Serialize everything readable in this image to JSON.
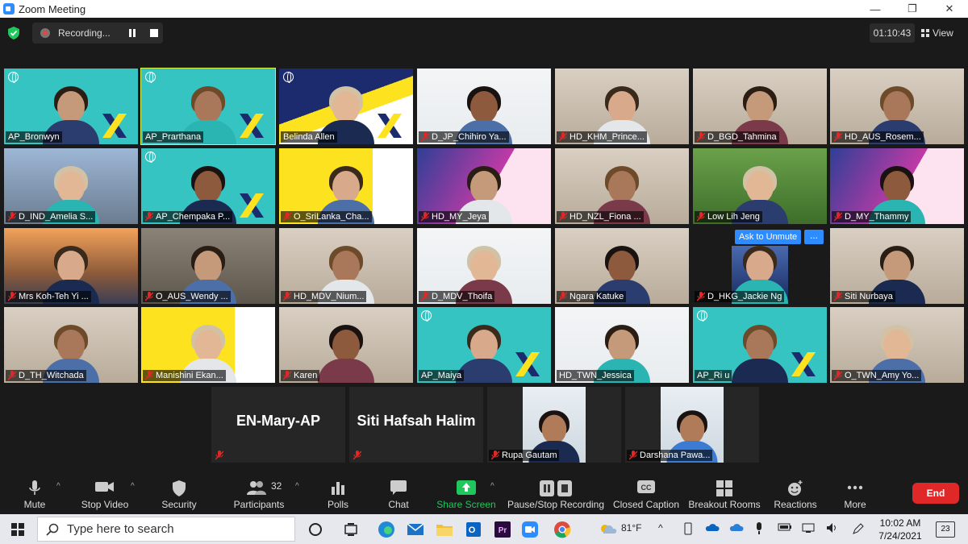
{
  "window": {
    "title": "Zoom Meeting"
  },
  "meeting": {
    "recording_label": "Recording...",
    "timer": "01:10:43",
    "view_label": "View"
  },
  "colors": {
    "teal": "#35c4c1",
    "yellow": "#fde21f",
    "navy": "#1c2b6e",
    "accent_blue": "#2d8cff",
    "end_red": "#e02828",
    "share_green": "#1fc75c"
  },
  "participants": [
    {
      "name": "AP_Bronwyn",
      "muted": false,
      "bg": "teal"
    },
    {
      "name": "AP_Prarthana",
      "muted": false,
      "bg": "teal",
      "active": true
    },
    {
      "name": "Belinda Allen",
      "muted": false,
      "bg": "navyyellow"
    },
    {
      "name": "D_JP_Chihiro Ya...",
      "muted": true,
      "bg": "white"
    },
    {
      "name": "HD_KHM_Prince...",
      "muted": true,
      "bg": "room"
    },
    {
      "name": "D_BGD_Tahmina",
      "muted": true,
      "bg": "room"
    },
    {
      "name": "HD_AUS_Rosem...",
      "muted": true,
      "bg": "room"
    },
    {
      "name": "D_IND_Amelia S...",
      "muted": true,
      "bg": "city"
    },
    {
      "name": "AP_Chempaka P...",
      "muted": true,
      "bg": "teal"
    },
    {
      "name": "O_SriLanka_Cha...",
      "muted": true,
      "bg": "yellow"
    },
    {
      "name": "HD_MY_Jeya",
      "muted": true,
      "bg": "wagggs"
    },
    {
      "name": "HD_NZL_Fiona ...",
      "muted": true,
      "bg": "room"
    },
    {
      "name": "Low Lih Jeng",
      "muted": true,
      "bg": "garden"
    },
    {
      "name": "D_MY_Thammy",
      "muted": true,
      "bg": "wagggs"
    },
    {
      "name": "Mrs Koh-Teh Yi ...",
      "muted": true,
      "bg": "sunset"
    },
    {
      "name": "O_AUS_Wendy ...",
      "muted": true,
      "bg": "girlguides"
    },
    {
      "name": "HD_MDV_Nium...",
      "muted": true,
      "bg": "room"
    },
    {
      "name": "D_MDV_Thoifa",
      "muted": true,
      "bg": "white"
    },
    {
      "name": "Ngara Katuke",
      "muted": true,
      "bg": "room"
    },
    {
      "name": "D_HKG_Jackie Ng",
      "muted": true,
      "bg": "dark",
      "ask_unmute": "Ask to Unmute",
      "more": "..."
    },
    {
      "name": "Siti Nurbaya",
      "muted": true,
      "bg": "room"
    },
    {
      "name": "D_TH_Witchada",
      "muted": true,
      "bg": "room"
    },
    {
      "name": "Manishini Ekan...",
      "muted": true,
      "bg": "yellow"
    },
    {
      "name": "Karen",
      "muted": true,
      "bg": "room"
    },
    {
      "name": "AP_Maiya",
      "muted": false,
      "bg": "teal"
    },
    {
      "name": "HD_TWN_Jessica",
      "muted": false,
      "bg": "white"
    },
    {
      "name": "AP_Ri u",
      "muted": false,
      "bg": "teal"
    },
    {
      "name": "O_TWN_Amy Yo...",
      "muted": true,
      "bg": "room"
    }
  ],
  "bottom_participants": [
    {
      "name": "EN-Mary-AP",
      "video": false
    },
    {
      "name": "Siti Hafsah Halim",
      "video": false
    },
    {
      "name": "Rupa Gautam",
      "video": true
    },
    {
      "name": "Darshana Pawa...",
      "video": true
    }
  ],
  "toolbar": {
    "mute": "Mute",
    "stop_video": "Stop Video",
    "security": "Security",
    "participants": "Participants",
    "participants_count": "32",
    "polls": "Polls",
    "chat": "Chat",
    "share_screen": "Share Screen",
    "pause_stop_recording": "Pause/Stop Recording",
    "closed_caption": "Closed Caption",
    "breakout_rooms": "Breakout Rooms",
    "reactions": "Reactions",
    "more": "More",
    "end": "End"
  },
  "taskbar": {
    "search_placeholder": "Type here to search",
    "temperature": "81°F",
    "time": "10:02 AM",
    "date": "7/24/2021",
    "notifications": "23"
  }
}
